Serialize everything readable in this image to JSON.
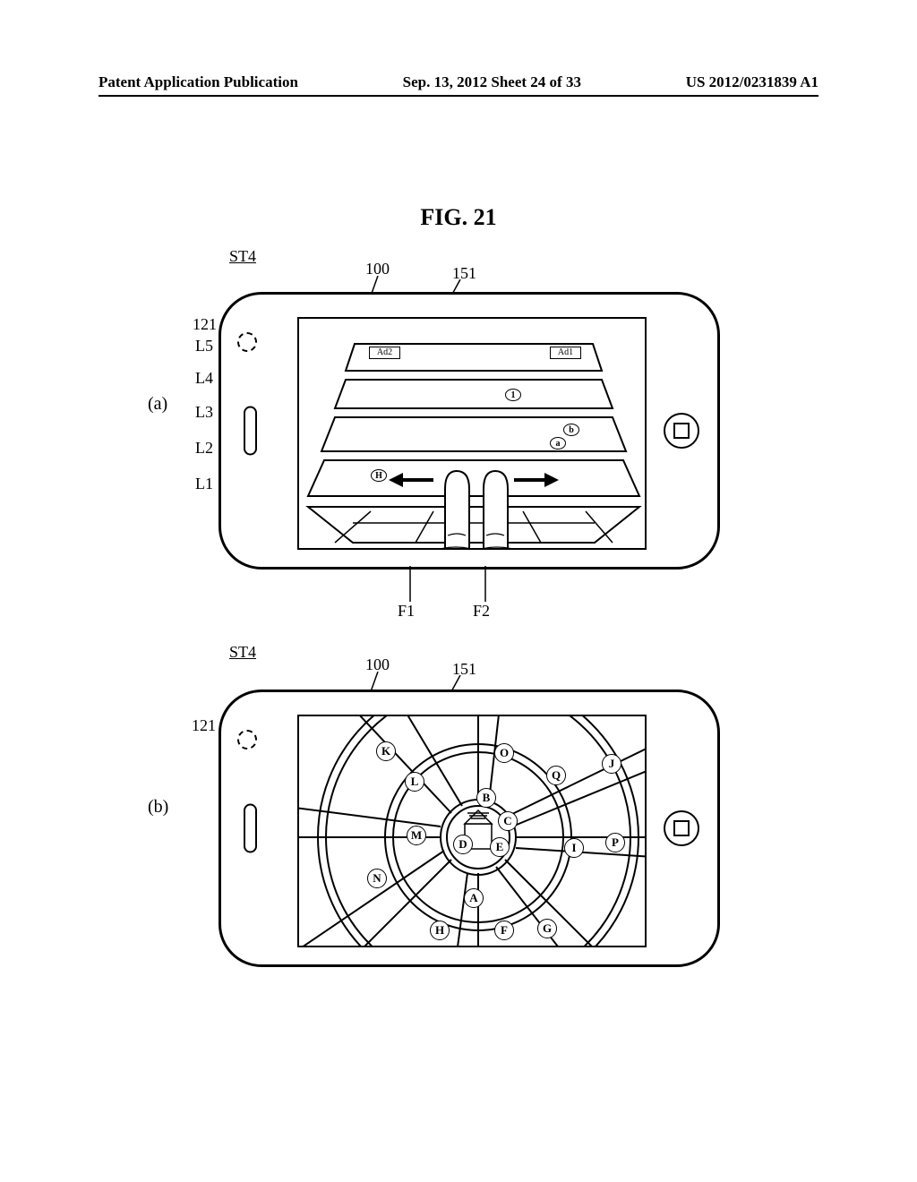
{
  "header": {
    "left": "Patent Application Publication",
    "center": "Sep. 13, 2012  Sheet 24 of 33",
    "right": "US 2012/0231839 A1"
  },
  "figure_title": "FIG. 21",
  "subfig_a": "(a)",
  "subfig_b": "(b)",
  "st_label": "ST4",
  "refs": {
    "body": "100",
    "screen": "151",
    "camera": "121",
    "f1": "F1",
    "f2": "F2"
  },
  "layers": {
    "l1": "L1",
    "l2": "L2",
    "l3": "L3",
    "l4": "L4",
    "l5": "L5"
  },
  "ads": {
    "ad1": "Ad1",
    "ad2": "Ad2"
  },
  "layer_markers": {
    "circ1": "1",
    "circb": "b",
    "circa": "a",
    "circH": "H"
  },
  "map_markers": {
    "K": "K",
    "O": "O",
    "J": "J",
    "L": "L",
    "Q": "Q",
    "B": "B",
    "M": "M",
    "C": "C",
    "D": "D",
    "E": "E",
    "I": "I",
    "P": "P",
    "N": "N",
    "A": "A",
    "H": "H",
    "F": "F",
    "G": "G"
  }
}
